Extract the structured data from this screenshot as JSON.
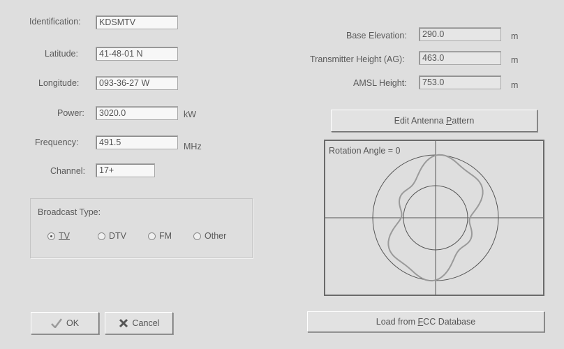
{
  "left_fields": {
    "identification": {
      "label": "Identification:",
      "value": "KDSMTV"
    },
    "latitude": {
      "label": "Latitude:",
      "value": "41-48-01 N"
    },
    "longitude": {
      "label": "Longitude:",
      "value": "093-36-27 W"
    },
    "power": {
      "label": "Power:",
      "value": "3020.0",
      "unit": "kW"
    },
    "frequency": {
      "label": "Frequency:",
      "value": "491.5",
      "unit": "MHz"
    },
    "channel": {
      "label": "Channel:",
      "value": "17+"
    }
  },
  "broadcast_type": {
    "title": "Broadcast Type:",
    "options": [
      "TV",
      "DTV",
      "FM",
      "Other"
    ],
    "selected": "TV"
  },
  "right_fields": {
    "base_elevation": {
      "label": "Base Elevation:",
      "value": "290.0",
      "unit": "m"
    },
    "transmitter_height": {
      "label": "Transmitter Height (AG):",
      "value": "463.0",
      "unit": "m"
    },
    "amsl_height": {
      "label": "AMSL Height:",
      "value": "753.0",
      "unit": "m"
    }
  },
  "buttons": {
    "edit_pattern": "Edit Antenna Pattern",
    "load_fcc": "Load from FCC Database",
    "ok": "OK",
    "cancel": "Cancel"
  },
  "pattern": {
    "rotation_label": "Rotation Angle = 0"
  },
  "colors": {
    "background": "#dedede",
    "pattern_curve": "#9a9a9a"
  }
}
